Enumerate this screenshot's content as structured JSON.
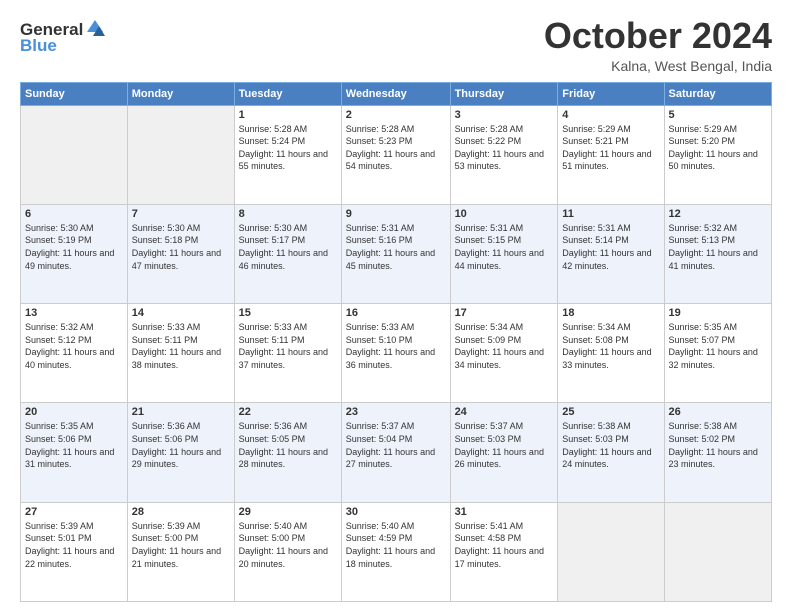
{
  "logo": {
    "general": "General",
    "blue": "Blue"
  },
  "header": {
    "month": "October 2024",
    "location": "Kalna, West Bengal, India"
  },
  "weekdays": [
    "Sunday",
    "Monday",
    "Tuesday",
    "Wednesday",
    "Thursday",
    "Friday",
    "Saturday"
  ],
  "weeks": [
    [
      {
        "day": "",
        "empty": true
      },
      {
        "day": "",
        "empty": true
      },
      {
        "day": "1",
        "sunrise": "Sunrise: 5:28 AM",
        "sunset": "Sunset: 5:24 PM",
        "daylight": "Daylight: 11 hours and 55 minutes."
      },
      {
        "day": "2",
        "sunrise": "Sunrise: 5:28 AM",
        "sunset": "Sunset: 5:23 PM",
        "daylight": "Daylight: 11 hours and 54 minutes."
      },
      {
        "day": "3",
        "sunrise": "Sunrise: 5:28 AM",
        "sunset": "Sunset: 5:22 PM",
        "daylight": "Daylight: 11 hours and 53 minutes."
      },
      {
        "day": "4",
        "sunrise": "Sunrise: 5:29 AM",
        "sunset": "Sunset: 5:21 PM",
        "daylight": "Daylight: 11 hours and 51 minutes."
      },
      {
        "day": "5",
        "sunrise": "Sunrise: 5:29 AM",
        "sunset": "Sunset: 5:20 PM",
        "daylight": "Daylight: 11 hours and 50 minutes."
      }
    ],
    [
      {
        "day": "6",
        "sunrise": "Sunrise: 5:30 AM",
        "sunset": "Sunset: 5:19 PM",
        "daylight": "Daylight: 11 hours and 49 minutes."
      },
      {
        "day": "7",
        "sunrise": "Sunrise: 5:30 AM",
        "sunset": "Sunset: 5:18 PM",
        "daylight": "Daylight: 11 hours and 47 minutes."
      },
      {
        "day": "8",
        "sunrise": "Sunrise: 5:30 AM",
        "sunset": "Sunset: 5:17 PM",
        "daylight": "Daylight: 11 hours and 46 minutes."
      },
      {
        "day": "9",
        "sunrise": "Sunrise: 5:31 AM",
        "sunset": "Sunset: 5:16 PM",
        "daylight": "Daylight: 11 hours and 45 minutes."
      },
      {
        "day": "10",
        "sunrise": "Sunrise: 5:31 AM",
        "sunset": "Sunset: 5:15 PM",
        "daylight": "Daylight: 11 hours and 44 minutes."
      },
      {
        "day": "11",
        "sunrise": "Sunrise: 5:31 AM",
        "sunset": "Sunset: 5:14 PM",
        "daylight": "Daylight: 11 hours and 42 minutes."
      },
      {
        "day": "12",
        "sunrise": "Sunrise: 5:32 AM",
        "sunset": "Sunset: 5:13 PM",
        "daylight": "Daylight: 11 hours and 41 minutes."
      }
    ],
    [
      {
        "day": "13",
        "sunrise": "Sunrise: 5:32 AM",
        "sunset": "Sunset: 5:12 PM",
        "daylight": "Daylight: 11 hours and 40 minutes."
      },
      {
        "day": "14",
        "sunrise": "Sunrise: 5:33 AM",
        "sunset": "Sunset: 5:11 PM",
        "daylight": "Daylight: 11 hours and 38 minutes."
      },
      {
        "day": "15",
        "sunrise": "Sunrise: 5:33 AM",
        "sunset": "Sunset: 5:11 PM",
        "daylight": "Daylight: 11 hours and 37 minutes."
      },
      {
        "day": "16",
        "sunrise": "Sunrise: 5:33 AM",
        "sunset": "Sunset: 5:10 PM",
        "daylight": "Daylight: 11 hours and 36 minutes."
      },
      {
        "day": "17",
        "sunrise": "Sunrise: 5:34 AM",
        "sunset": "Sunset: 5:09 PM",
        "daylight": "Daylight: 11 hours and 34 minutes."
      },
      {
        "day": "18",
        "sunrise": "Sunrise: 5:34 AM",
        "sunset": "Sunset: 5:08 PM",
        "daylight": "Daylight: 11 hours and 33 minutes."
      },
      {
        "day": "19",
        "sunrise": "Sunrise: 5:35 AM",
        "sunset": "Sunset: 5:07 PM",
        "daylight": "Daylight: 11 hours and 32 minutes."
      }
    ],
    [
      {
        "day": "20",
        "sunrise": "Sunrise: 5:35 AM",
        "sunset": "Sunset: 5:06 PM",
        "daylight": "Daylight: 11 hours and 31 minutes."
      },
      {
        "day": "21",
        "sunrise": "Sunrise: 5:36 AM",
        "sunset": "Sunset: 5:06 PM",
        "daylight": "Daylight: 11 hours and 29 minutes."
      },
      {
        "day": "22",
        "sunrise": "Sunrise: 5:36 AM",
        "sunset": "Sunset: 5:05 PM",
        "daylight": "Daylight: 11 hours and 28 minutes."
      },
      {
        "day": "23",
        "sunrise": "Sunrise: 5:37 AM",
        "sunset": "Sunset: 5:04 PM",
        "daylight": "Daylight: 11 hours and 27 minutes."
      },
      {
        "day": "24",
        "sunrise": "Sunrise: 5:37 AM",
        "sunset": "Sunset: 5:03 PM",
        "daylight": "Daylight: 11 hours and 26 minutes."
      },
      {
        "day": "25",
        "sunrise": "Sunrise: 5:38 AM",
        "sunset": "Sunset: 5:03 PM",
        "daylight": "Daylight: 11 hours and 24 minutes."
      },
      {
        "day": "26",
        "sunrise": "Sunrise: 5:38 AM",
        "sunset": "Sunset: 5:02 PM",
        "daylight": "Daylight: 11 hours and 23 minutes."
      }
    ],
    [
      {
        "day": "27",
        "sunrise": "Sunrise: 5:39 AM",
        "sunset": "Sunset: 5:01 PM",
        "daylight": "Daylight: 11 hours and 22 minutes."
      },
      {
        "day": "28",
        "sunrise": "Sunrise: 5:39 AM",
        "sunset": "Sunset: 5:00 PM",
        "daylight": "Daylight: 11 hours and 21 minutes."
      },
      {
        "day": "29",
        "sunrise": "Sunrise: 5:40 AM",
        "sunset": "Sunset: 5:00 PM",
        "daylight": "Daylight: 11 hours and 20 minutes."
      },
      {
        "day": "30",
        "sunrise": "Sunrise: 5:40 AM",
        "sunset": "Sunset: 4:59 PM",
        "daylight": "Daylight: 11 hours and 18 minutes."
      },
      {
        "day": "31",
        "sunrise": "Sunrise: 5:41 AM",
        "sunset": "Sunset: 4:58 PM",
        "daylight": "Daylight: 11 hours and 17 minutes."
      },
      {
        "day": "",
        "empty": true
      },
      {
        "day": "",
        "empty": true
      }
    ]
  ]
}
